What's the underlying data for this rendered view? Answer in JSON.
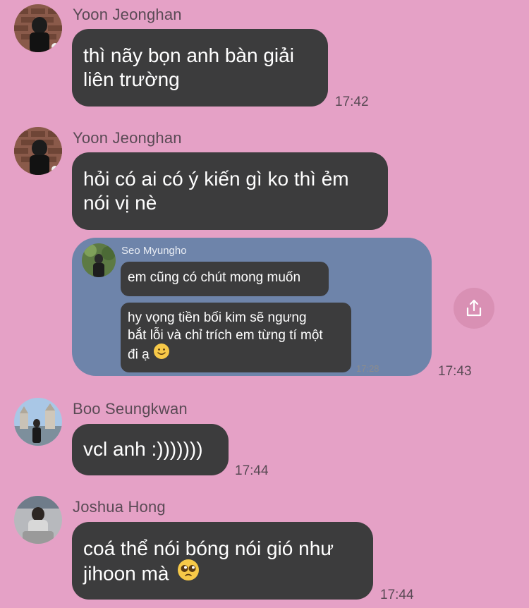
{
  "messages": [
    {
      "sender": "Yoon Jeonghan",
      "lines": [
        "thì nãy bọn anh bàn giải",
        "liên trường"
      ],
      "time": "17:42"
    },
    {
      "sender": "Yoon Jeonghan",
      "lines": [
        "hỏi có ai có ý kiến gì ko thì ẻm",
        "nói vị nè"
      ]
    }
  ],
  "forwarded": {
    "sender": "Seo Myungho",
    "bubble1": "em cũng có chút mong muốn",
    "bubble2_lines": [
      "hy vọng tiền bối kim sẽ ngưng",
      "bắt lỗi và chỉ trích em từng tí một",
      "đi ạ"
    ],
    "inner_time": "17:28",
    "time": "17:43"
  },
  "message3": {
    "sender": "Boo Seungkwan",
    "text": "vcl anh :)))))))",
    "time": "17:44"
  },
  "message4": {
    "sender": "Joshua Hong",
    "lines": [
      "coá thể nói bóng nói gió như",
      "jihoon mà"
    ],
    "time": "17:44"
  },
  "icons": {
    "share": "share-icon",
    "smile": "slightly-smiling-face-emoji",
    "pleading": "pleading-face-emoji"
  },
  "colors": {
    "background": "#e5a1c6",
    "bubble": "#3c3c3d",
    "forward_card": "#6e84aa",
    "share_button": "#d990b4"
  }
}
